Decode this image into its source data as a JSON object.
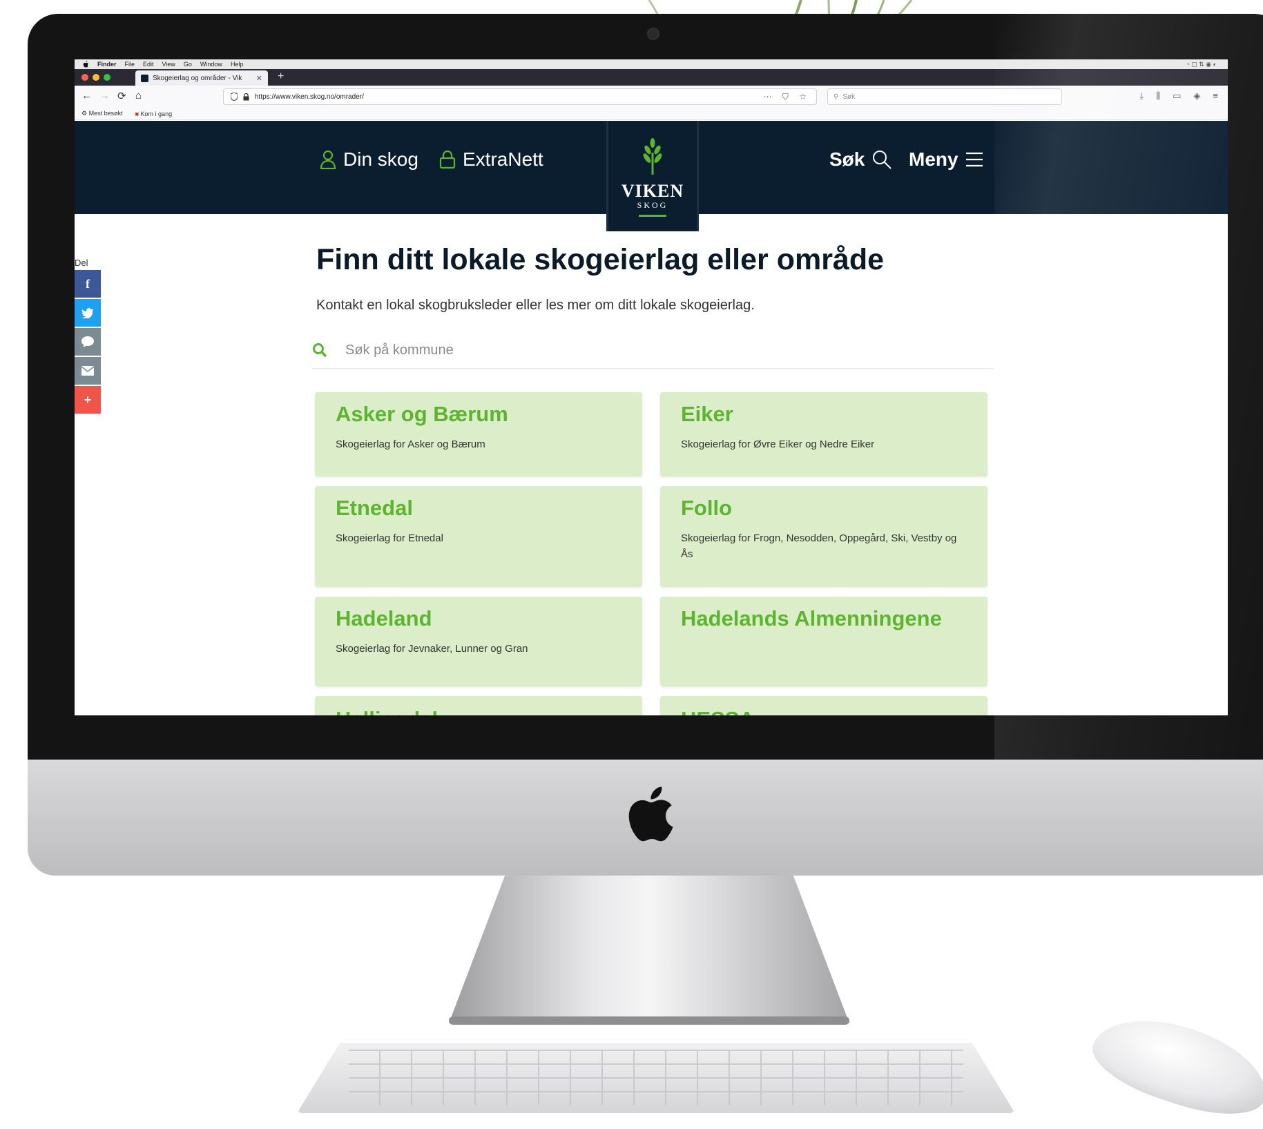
{
  "browser": {
    "menubar": {
      "items": [
        "Finder",
        "File",
        "Edit",
        "View",
        "Go",
        "Window",
        "Help"
      ]
    },
    "tab_title": "Skogeierlag og områder - Vik",
    "url": "https://www.viken.skog.no/omrader/",
    "search_placeholder": "Søk",
    "bookmarks": [
      "Mest besøkt",
      "Kom i gang"
    ]
  },
  "site": {
    "nav_left": [
      {
        "label": "Din skog",
        "icon": "person-icon"
      },
      {
        "label": "ExtraNett",
        "icon": "lock-icon"
      }
    ],
    "logo": {
      "name": "VIKEN",
      "sub": "SKOG"
    },
    "nav_right": [
      {
        "label": "Søk",
        "icon": "search-icon"
      },
      {
        "label": "Meny",
        "icon": "hamburger-icon"
      }
    ],
    "colors": {
      "header": "#0b1e30",
      "accent": "#5db42e",
      "card": "#dcedc9"
    }
  },
  "share": {
    "label": "Del",
    "buttons": [
      {
        "name": "facebook",
        "glyph": "f",
        "color": "#3b5998"
      },
      {
        "name": "twitter",
        "glyph": "t",
        "color": "#1da1f2"
      },
      {
        "name": "messenger",
        "glyph": "m",
        "color": "#7b8a93"
      },
      {
        "name": "email",
        "glyph": "✉",
        "color": "#7b8a93"
      },
      {
        "name": "more",
        "glyph": "+",
        "color": "#f0554a"
      }
    ]
  },
  "main": {
    "title": "Finn ditt lokale skogeierlag eller område",
    "subtitle": "Kontakt en lokal skogbruksleder eller les mer om ditt lokale skogeierlag.",
    "search_placeholder": "Søk på kommune",
    "cards": [
      {
        "title": "Asker og Bærum",
        "desc": "Skogeierlag for Asker og Bærum"
      },
      {
        "title": "Eiker",
        "desc": "Skogeierlag for Øvre Eiker og Nedre Eiker"
      },
      {
        "title": "Etnedal",
        "desc": "Skogeierlag for Etnedal"
      },
      {
        "title": "Follo",
        "desc": "Skogeierlag for Frogn, Nesodden, Oppegård, Ski, Vestby og Ås"
      },
      {
        "title": "Hadeland",
        "desc": "Skogeierlag for Jevnaker, Lunner og Gran"
      },
      {
        "title": "Hadelands Almenningene",
        "desc": ""
      },
      {
        "title": "Hallingdal",
        "desc": ""
      },
      {
        "title": "HESSA",
        "desc": ""
      }
    ]
  }
}
